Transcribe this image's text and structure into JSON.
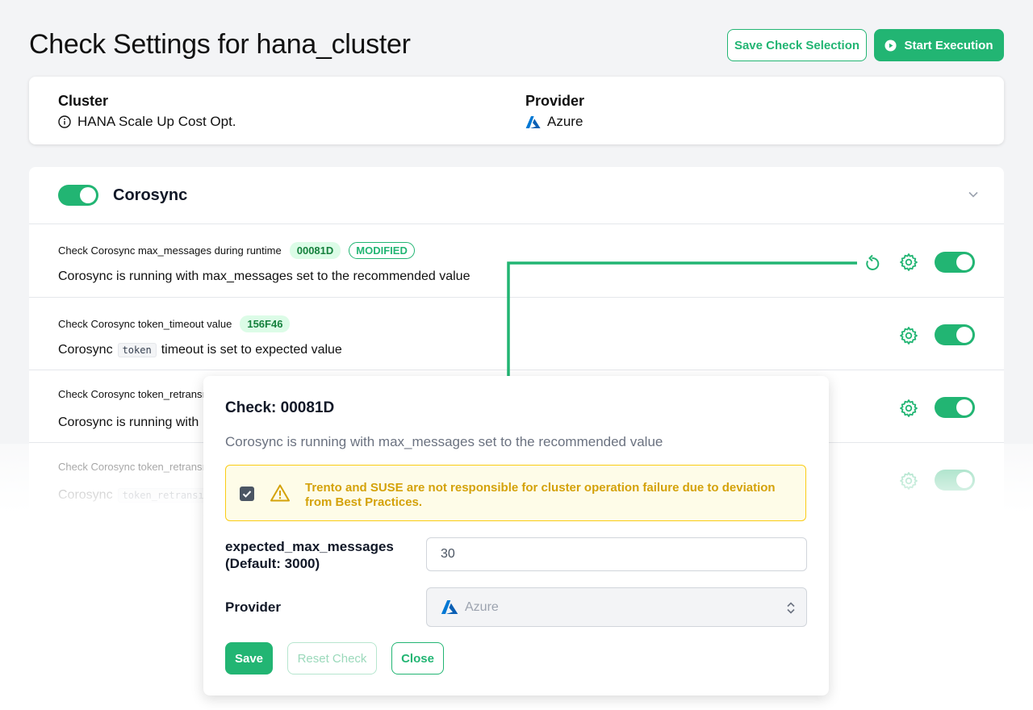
{
  "page": {
    "title": "Check Settings for hana_cluster"
  },
  "actions": {
    "save_selection": "Save Check Selection",
    "start_execution": "Start Execution"
  },
  "cluster_info": {
    "cluster_label": "Cluster",
    "cluster_value": "HANA Scale Up Cost Opt.",
    "provider_label": "Provider",
    "provider_value": "Azure"
  },
  "group": {
    "name": "Corosync",
    "enabled": true
  },
  "checks": [
    {
      "title": "Check Corosync max_messages during runtime",
      "id": "00081D",
      "badge": "MODIFIED",
      "desc": "Corosync is running with max_messages set to the recommended value",
      "enabled": true
    },
    {
      "title": "Check Corosync token_timeout value",
      "id": "156F46",
      "desc_pre": "Corosync",
      "desc_code": "token",
      "desc_post": "timeout is set to expected value",
      "enabled": true
    },
    {
      "title": "Check Corosync token_retransı",
      "desc_pre": "Corosync is running with",
      "enabled": true
    },
    {
      "title": "Check Corosync token_retransı",
      "desc_pre": "Corosync",
      "desc_code": "token_retransı",
      "enabled": true
    }
  ],
  "modal": {
    "title": "Check: 00081D",
    "subtitle": "Corosync is running with max_messages set to the recommended value",
    "warning": "Trento and SUSE are not responsible for cluster operation failure due to deviation from Best Practices.",
    "warning_checked": true,
    "field1_label": "expected_max_messages",
    "field1_default": "(Default: 3000)",
    "field1_value": "30",
    "field2_label": "Provider",
    "field2_value": "Azure",
    "save": "Save",
    "reset": "Reset Check",
    "close": "Close"
  },
  "colors": {
    "accent": "#22b573",
    "warning_text": "#d4a20a",
    "azure": "#0078d4"
  }
}
